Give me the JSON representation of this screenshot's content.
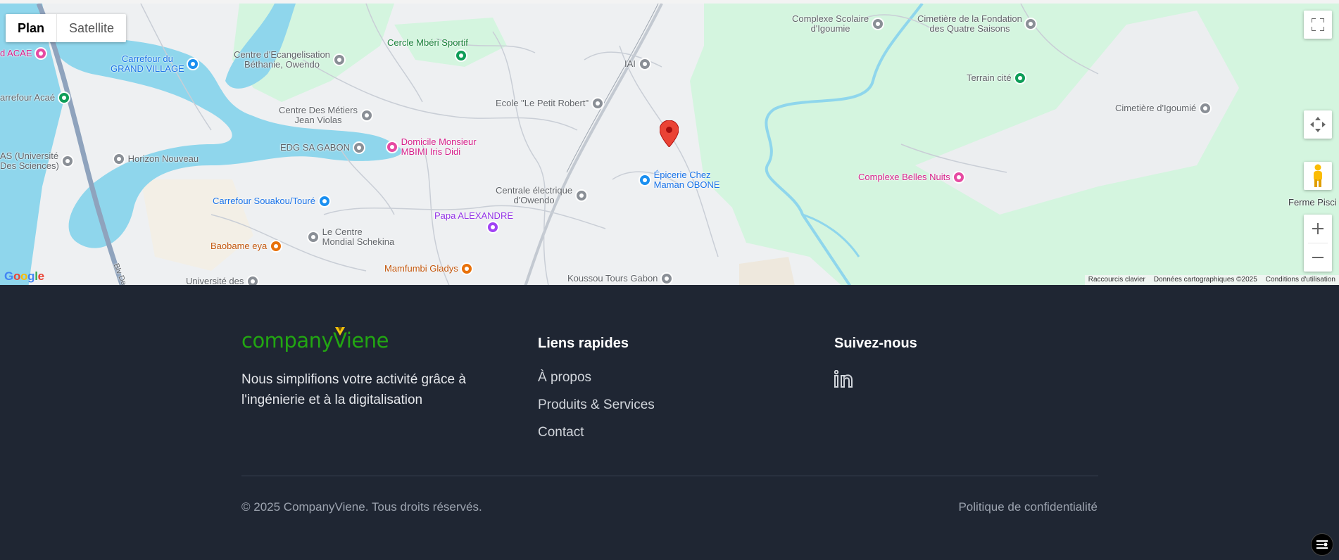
{
  "map": {
    "type_controls": {
      "plan": "Plan",
      "satellite": "Satellite"
    },
    "pois": [
      {
        "name": "poi-cercle-mberi",
        "text": "Cercle Mbéri Sportif",
        "cat": "green"
      },
      {
        "name": "poi-complexe-scolaire",
        "text": "Complexe Scolaire\nd'Igoumie",
        "cat": "gray"
      },
      {
        "name": "poi-cimetiere-fondation",
        "text": "Cimetière de la Fondation\ndes Quatre Saisons",
        "cat": "gray"
      },
      {
        "name": "poi-carrefour-grand-village",
        "text": "Carrefour du\nGRAND VILLAGE",
        "cat": "blue"
      },
      {
        "name": "poi-centre-ecangelisation",
        "text": "Centre d'Ecangelisation\nBéthanie, Owendo",
        "cat": "gray"
      },
      {
        "name": "poi-iai",
        "text": "IAI",
        "cat": "gray"
      },
      {
        "name": "poi-terrain-cite",
        "text": "Terrain cité",
        "cat": "green"
      },
      {
        "name": "poi-acae",
        "text": "d ACAE",
        "cat": "pink"
      },
      {
        "name": "poi-carrefour-acae",
        "text": "arrefour Acaé",
        "cat": "gray"
      },
      {
        "name": "poi-ecole-petit-robert",
        "text": "Ecole \"Le Petit Robert\"",
        "cat": "gray"
      },
      {
        "name": "poi-cimetiere-igoumie",
        "text": "Cimetière d'Igoumié",
        "cat": "gray"
      },
      {
        "name": "poi-centre-metiers",
        "text": "Centre Des Métiers\nJean Violas",
        "cat": "gray"
      },
      {
        "name": "poi-domicile-mbimi",
        "text": "Domicile Monsieur\nMBIMI Iris Didi",
        "cat": "pink"
      },
      {
        "name": "poi-edg-gabon",
        "text": "EDG SA GABON",
        "cat": "gray"
      },
      {
        "name": "poi-universite-sciences",
        "text": "AS (Université\nDes Sciences)",
        "cat": "gray"
      },
      {
        "name": "poi-horizon-nouveau",
        "text": "Horizon Nouveau",
        "cat": "gray"
      },
      {
        "name": "poi-epicerie-obone",
        "text": "Épicerie Chez\nMaman OBONE",
        "cat": "blue"
      },
      {
        "name": "poi-complexe-belles-nuits",
        "text": "Complexe Belles Nuits",
        "cat": "pink"
      },
      {
        "name": "poi-centrale-electrique",
        "text": "Centrale électrique\nd'Owendo",
        "cat": "gray"
      },
      {
        "name": "poi-carrefour-souakou",
        "text": "Carrefour Souakou/Touré",
        "cat": "blue"
      },
      {
        "name": "poi-ferme-pisci",
        "text": "Ferme Pisci",
        "cat": "gray"
      },
      {
        "name": "poi-papa-alexandre",
        "text": "Papa ALEXANDRE",
        "cat": "purple"
      },
      {
        "name": "poi-centre-mondial",
        "text": "Le Centre\nMondial Schekina",
        "cat": "gray"
      },
      {
        "name": "poi-baobame-eya",
        "text": "Baobame eya",
        "cat": "orange"
      },
      {
        "name": "poi-mamfumbi-gladys",
        "text": "Mamfumbi Gladys",
        "cat": "orange"
      },
      {
        "name": "poi-universite-des",
        "text": "Université des",
        "cat": "gray"
      },
      {
        "name": "poi-koussou-tours",
        "text": "Koussou Tours Gabon",
        "cat": "gray"
      },
      {
        "name": "road-blvd",
        "text": "Blv De",
        "cat": "gray"
      }
    ],
    "google_logo": "Google",
    "attribution": {
      "shortcuts": "Raccourcis clavier",
      "data": "Données cartographiques ©2025",
      "terms": "Conditions d'utilisation"
    }
  },
  "footer": {
    "logo": {
      "part1": "company",
      "part2": "Viene"
    },
    "tagline": "Nous simplifions votre activité grâce à l'ingénierie et à la digitalisation",
    "quick_links": {
      "heading": "Liens rapides",
      "items": [
        "À propos",
        "Produits & Services",
        "Contact"
      ]
    },
    "follow": {
      "heading": "Suivez-nous",
      "icon": "linkedin-icon"
    },
    "copyright": "© 2025 CompanyViene. Tous droits réservés.",
    "privacy": "Politique de confidentialité"
  },
  "colors": {
    "footer_bg": "#1f2633",
    "logo_green": "#22a612",
    "map_park": "#d4f5df",
    "map_water": "#8fd6ec",
    "marker_red": "#ea4335"
  }
}
